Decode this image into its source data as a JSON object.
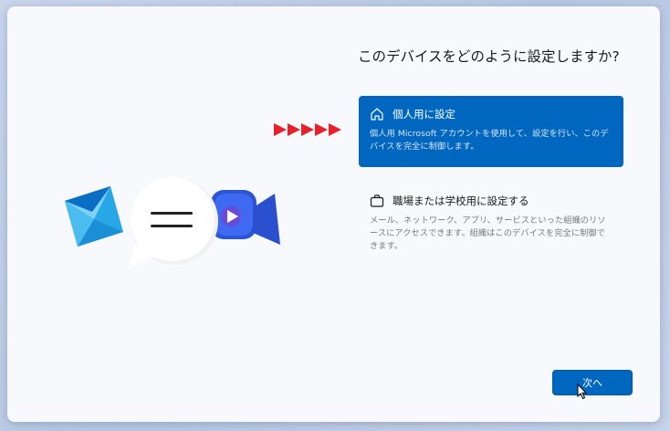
{
  "page": {
    "title": "このデバイスをどのように設定しますか?"
  },
  "options": [
    {
      "label": "個人用に設定",
      "description": "個人用 Microsoft アカウントを使用して、設定を行い、このデバイスを完全に制御します。",
      "icon": "home-icon",
      "selected": true
    },
    {
      "label": "職場または学校用に設定する",
      "description": "メール、ネットワーク、アプリ、サービスといった組織のリソースにアクセスできます。組織はこのデバイスを完全に制御できます。",
      "icon": "briefcase-icon",
      "selected": false
    }
  ],
  "footer": {
    "next_label": "次へ"
  },
  "colors": {
    "accent": "#0067c0",
    "annotation_arrows": "#e8202a"
  }
}
